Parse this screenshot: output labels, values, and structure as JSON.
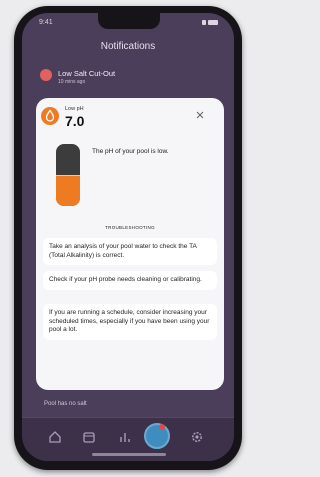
{
  "status": {
    "time": "9:41"
  },
  "header": {
    "title": "Notifications"
  },
  "notification": {
    "title": "Low Salt Cut-Out",
    "time": "10 mins ago"
  },
  "list_bottom": {
    "text": "Pool has no salt"
  },
  "modal": {
    "label": "Low pH",
    "value": "7.0",
    "description": "The pH of your pool is low.",
    "gauge_level": 0.5,
    "section_title": "TROUBLESHOOTING",
    "tips": [
      "Take an analysis of your pool water to check the TA (Total Alkalinity) is correct.",
      "Check if your pH probe needs cleaning or calibrating.",
      "If you are running a schedule, consider increasing your scheduled times, especially if you have been using your pool a lot."
    ]
  },
  "colors": {
    "accent": "#ef7a24",
    "overlay": "#4b3e5a",
    "nav_active": "#3f8dbf",
    "alert": "#e84545"
  },
  "icons": {
    "ph": "water-drop-icon",
    "close": "close-icon",
    "nav": [
      "home-icon",
      "calendar-icon",
      "stats-icon",
      "pool-icon",
      "settings-icon"
    ]
  }
}
